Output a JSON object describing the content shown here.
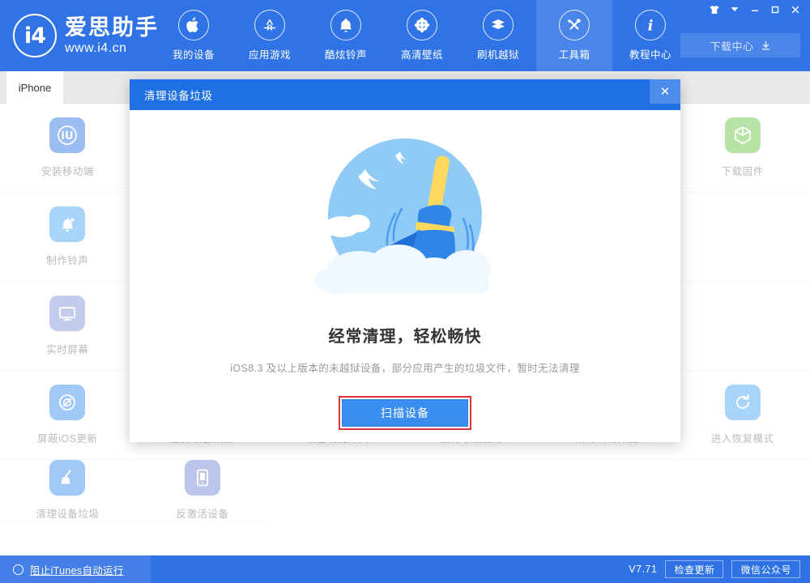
{
  "app": {
    "logo_initials": "i4",
    "logo_title": "爱思助手",
    "logo_url": "www.i4.cn"
  },
  "header": {
    "nav": [
      {
        "label": "我的设备",
        "icon": "apple-icon",
        "active": false
      },
      {
        "label": "应用游戏",
        "icon": "appstore-icon",
        "active": false
      },
      {
        "label": "酷炫铃声",
        "icon": "bell-icon",
        "active": false
      },
      {
        "label": "高清壁纸",
        "icon": "flower-icon",
        "active": false
      },
      {
        "label": "刷机越狱",
        "icon": "box-icon",
        "active": false
      },
      {
        "label": "工具箱",
        "icon": "tools-icon",
        "active": true
      },
      {
        "label": "教程中心",
        "icon": "info-icon",
        "active": false
      }
    ],
    "window_controls": [
      {
        "name": "skin-icon",
        "glyph": "shirt"
      },
      {
        "name": "menu-dropdown-icon",
        "glyph": "caret"
      },
      {
        "name": "minimize-icon",
        "glyph": "minimize"
      },
      {
        "name": "maximize-icon",
        "glyph": "maximize"
      },
      {
        "name": "close-icon",
        "glyph": "close"
      }
    ],
    "download_center": {
      "label": "下载中心",
      "icon": "download-icon"
    }
  },
  "tabs": [
    {
      "label": "iPhone",
      "active": true
    }
  ],
  "toolbox": {
    "cells": [
      {
        "label": "安装移动端",
        "icon": "i4-app-icon",
        "color": "#1f6fe0",
        "empty": false
      },
      {
        "label": "",
        "icon": "",
        "color": "",
        "empty": true
      },
      {
        "label": "",
        "icon": "",
        "color": "",
        "empty": true
      },
      {
        "label": "",
        "icon": "",
        "color": "",
        "empty": true
      },
      {
        "label": "",
        "icon": "",
        "color": "",
        "empty": true
      },
      {
        "label": "下载固件",
        "icon": "cube-icon",
        "color": "#5fc13a",
        "empty": false
      },
      {
        "label": "制作铃声",
        "icon": "bell-plus-icon",
        "color": "#3fa0f5",
        "empty": false
      },
      {
        "label": "",
        "icon": "",
        "color": "",
        "empty": true
      },
      {
        "label": "",
        "icon": "",
        "color": "",
        "empty": true
      },
      {
        "label": "",
        "icon": "",
        "color": "",
        "empty": true
      },
      {
        "label": "",
        "icon": "",
        "color": "",
        "empty": true
      },
      {
        "label": "",
        "icon": "",
        "color": "",
        "empty": true
      },
      {
        "label": "实时屏幕",
        "icon": "monitor-icon",
        "color": "#7b8fd4",
        "empty": false
      },
      {
        "label": "",
        "icon": "",
        "color": "",
        "empty": true
      },
      {
        "label": "",
        "icon": "",
        "color": "",
        "empty": true
      },
      {
        "label": "",
        "icon": "",
        "color": "",
        "empty": true
      },
      {
        "label": "",
        "icon": "",
        "color": "",
        "empty": true
      },
      {
        "label": "",
        "icon": "",
        "color": "",
        "empty": true
      },
      {
        "label": "屏蔽iOS更新",
        "icon": "gear-block-icon",
        "color": "#2f87f0",
        "empty": false
      },
      {
        "label": "虚拟设备桌面",
        "icon": "desktop-icon",
        "color": "#7b8fd4",
        "empty": false
      },
      {
        "label": "设备功能开关",
        "icon": "switch-icon",
        "color": "#3fa0f5",
        "empty": false
      },
      {
        "label": "删除歌曲图标",
        "icon": "music-remove-icon",
        "color": "#f0603a",
        "empty": false
      },
      {
        "label": "清除所有数据",
        "icon": "erase-icon",
        "color": "#f0a03a",
        "empty": false
      },
      {
        "label": "进入恢复模式",
        "icon": "recovery-icon",
        "color": "#3fa0f5",
        "empty": false
      },
      {
        "label": "清理设备垃圾",
        "icon": "broom-icon",
        "color": "#2f87f0",
        "empty": false
      },
      {
        "label": "反激活设备",
        "icon": "deactivate-icon",
        "color": "#6b7fd0",
        "empty": false
      }
    ]
  },
  "dialog": {
    "title": "清理设备垃圾",
    "close_label": "✕",
    "heading": "经常清理，轻松畅快",
    "subtitle": "iOS8.3 及以上版本的未越狱设备，部分应用产生的垃圾文件，暂时无法清理",
    "scan_button": "扫描设备",
    "highlight_color": "#e0353f"
  },
  "footer": {
    "itunes_toggle": "阻止iTunes自动运行",
    "version": "V7.71",
    "check_update": "检查更新",
    "wechat": "微信公众号"
  }
}
